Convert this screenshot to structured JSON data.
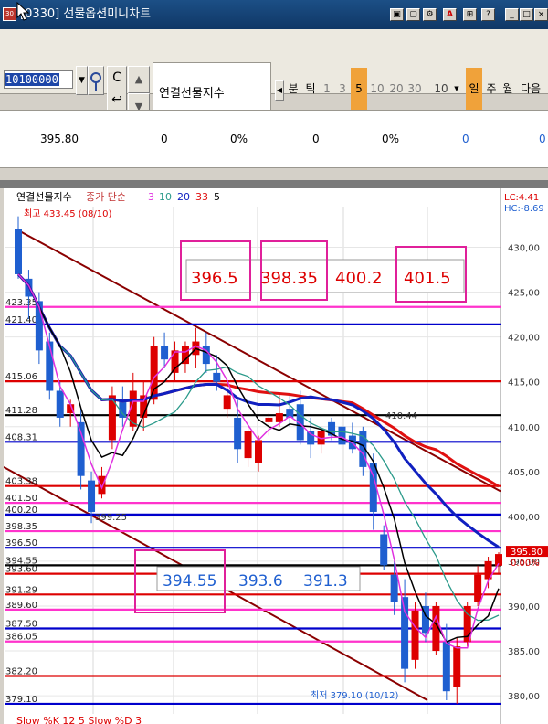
{
  "window": {
    "title": "[0330] 선물옵션미니차트",
    "app_icon_label": "30"
  },
  "toolbar": {
    "code_value": "10100000",
    "name_value": "연결선물지수",
    "periods": [
      {
        "label": "분",
        "state": "normal"
      },
      {
        "label": "틱",
        "state": "normal"
      },
      {
        "label": "1",
        "state": "dim"
      },
      {
        "label": "3",
        "state": "dim"
      },
      {
        "label": "5",
        "state": "active"
      },
      {
        "label": "10",
        "state": "dim"
      },
      {
        "label": "20",
        "state": "dim"
      },
      {
        "label": "30",
        "state": "dim"
      }
    ],
    "tick_count": "10",
    "day_label": "일",
    "week_label": "주",
    "month_label": "월",
    "next_label": "다음"
  },
  "quote": {
    "price": "395.80",
    "v1": "0",
    "p1": "0%",
    "v2": "0",
    "p2": "0%",
    "v3": "0",
    "v4": "0"
  },
  "chart": {
    "legend_name": "연결선물지수",
    "legend_ma_label": "종가 단순",
    "legend_ma_values": [
      "3",
      "10",
      "20",
      "33",
      "5"
    ],
    "lc_label": "LC:4.41",
    "hc_label": "HC:-8.69",
    "high_label": "최고 433.45 (08/10)",
    "low_label": "최저 379.10 (10/12)",
    "point_label_1": "399.25",
    "point_label_2": "410.44",
    "current_price_tag": "395.80",
    "current_pct_tag": "0.00%",
    "box_top_values": [
      "396.5",
      "398.35",
      "400.2",
      "401.5"
    ],
    "box_bottom_values": [
      "394.55",
      "393.6",
      "391.3"
    ],
    "bottom_indicator": "Slow %K 12 5   Slow %D 3"
  },
  "chart_data": {
    "type": "candlestick",
    "y_ticks": [
      "430,00",
      "425,00",
      "420,00",
      "415,00",
      "410,00",
      "405,00",
      "400,00",
      "395,00",
      "390,00",
      "385,00",
      "380,00"
    ],
    "ylim": [
      379.5,
      432.5
    ],
    "levels": [
      {
        "label": "423.35",
        "value": 423.35,
        "color": "#ff33cc"
      },
      {
        "label": "421.40",
        "value": 421.4,
        "color": "#0000cc"
      },
      {
        "label": "415.06",
        "value": 415.06,
        "color": "#dd0000"
      },
      {
        "label": "411.28",
        "value": 411.28,
        "color": "#000000"
      },
      {
        "label": "408.31",
        "value": 408.31,
        "color": "#0000cc"
      },
      {
        "label": "403.38",
        "value": 403.38,
        "color": "#dd0000"
      },
      {
        "label": "401.50",
        "value": 401.5,
        "color": "#ff33cc"
      },
      {
        "label": "400.20",
        "value": 400.2,
        "color": "#0000cc"
      },
      {
        "label": "398.35",
        "value": 398.35,
        "color": "#ff33cc"
      },
      {
        "label": "396.50",
        "value": 396.5,
        "color": "#0000cc"
      },
      {
        "label": "394.55",
        "value": 394.55,
        "color": "#000000"
      },
      {
        "label": "393.60",
        "value": 393.6,
        "color": "#dd0000"
      },
      {
        "label": "391.29",
        "value": 391.29,
        "color": "#dd0000"
      },
      {
        "label": "389.60",
        "value": 389.6,
        "color": "#ff33cc"
      },
      {
        "label": "387.50",
        "value": 387.5,
        "color": "#0000cc"
      },
      {
        "label": "386.05",
        "value": 386.05,
        "color": "#ff33cc"
      },
      {
        "label": "382.20",
        "value": 382.2,
        "color": "#dd0000"
      },
      {
        "label": "379.10",
        "value": 379.1,
        "color": "#0000cc"
      }
    ],
    "candles": [
      [
        432.0,
        433.45,
        426.5,
        427.0
      ],
      [
        426.5,
        427.5,
        422.0,
        424.5
      ],
      [
        424.0,
        425.0,
        417.0,
        418.5
      ],
      [
        419.5,
        420.5,
        413.0,
        414.0
      ],
      [
        414.0,
        415.0,
        410.0,
        411.0
      ],
      [
        411.5,
        413.0,
        410.0,
        412.5
      ],
      [
        410.5,
        412.0,
        403.0,
        404.5
      ],
      [
        404.0,
        405.0,
        399.25,
        400.5
      ],
      [
        402.5,
        405.5,
        402.0,
        404.5
      ],
      [
        408.5,
        414.5,
        407.5,
        413.5
      ],
      [
        413.0,
        414.5,
        410.0,
        411.0
      ],
      [
        410.0,
        416.0,
        409.5,
        414.0
      ],
      [
        411.0,
        415.0,
        409.5,
        413.5
      ],
      [
        413.0,
        420.0,
        412.5,
        419.0
      ],
      [
        419.0,
        420.5,
        416.5,
        417.5
      ],
      [
        416.0,
        419.5,
        415.0,
        418.5
      ],
      [
        417.0,
        419.5,
        416.0,
        419.0
      ],
      [
        418.0,
        421.0,
        416.5,
        419.5
      ],
      [
        419.0,
        420.5,
        416.0,
        417.0
      ],
      [
        416.0,
        418.0,
        414.0,
        415.0
      ],
      [
        412.0,
        414.5,
        411.0,
        413.5
      ],
      [
        411.0,
        413.0,
        406.0,
        407.5
      ],
      [
        406.5,
        410.0,
        405.5,
        409.5
      ],
      [
        406.0,
        409.0,
        405.0,
        408.5
      ],
      [
        410.5,
        411.5,
        409.0,
        411.0
      ],
      [
        410.5,
        413.5,
        410.0,
        411.5
      ],
      [
        412.0,
        413.5,
        410.0,
        411.0
      ],
      [
        412.5,
        414.0,
        408.0,
        408.5
      ],
      [
        409.5,
        411.0,
        406.5,
        408.0
      ],
      [
        408.0,
        410.0,
        407.0,
        409.5
      ],
      [
        410.5,
        411.0,
        408.5,
        409.0
      ],
      [
        410.0,
        410.5,
        407.5,
        408.0
      ],
      [
        409.0,
        410.44,
        407.0,
        407.5
      ],
      [
        409.5,
        410.0,
        404.5,
        405.5
      ],
      [
        406.0,
        407.0,
        398.5,
        400.5
      ],
      [
        398.0,
        399.0,
        394.0,
        394.55
      ],
      [
        393.5,
        395.0,
        389.0,
        390.5
      ],
      [
        391.0,
        393.0,
        381.5,
        383.0
      ],
      [
        384.0,
        390.5,
        383.0,
        389.5
      ],
      [
        390.0,
        391.5,
        386.0,
        387.0
      ],
      [
        385.0,
        390.5,
        384.5,
        390.0
      ],
      [
        386.0,
        388.0,
        379.5,
        380.5
      ],
      [
        381.0,
        386.5,
        379.1,
        385.5
      ],
      [
        386.0,
        390.5,
        385.5,
        390.0
      ],
      [
        390.5,
        394.5,
        390.0,
        393.5
      ],
      [
        393.0,
        395.5,
        392.0,
        395.0
      ],
      [
        394.5,
        396.0,
        393.5,
        395.8
      ]
    ]
  },
  "colors": {
    "up": "#dd0000",
    "down": "#1f5fd0",
    "ma_black": "#000000",
    "ma_magenta": "#e030e0",
    "ma_teal": "#2a9a8a",
    "ma_blue": "#1020c0",
    "ma_red": "#e01010",
    "trend": "#8b0000"
  }
}
